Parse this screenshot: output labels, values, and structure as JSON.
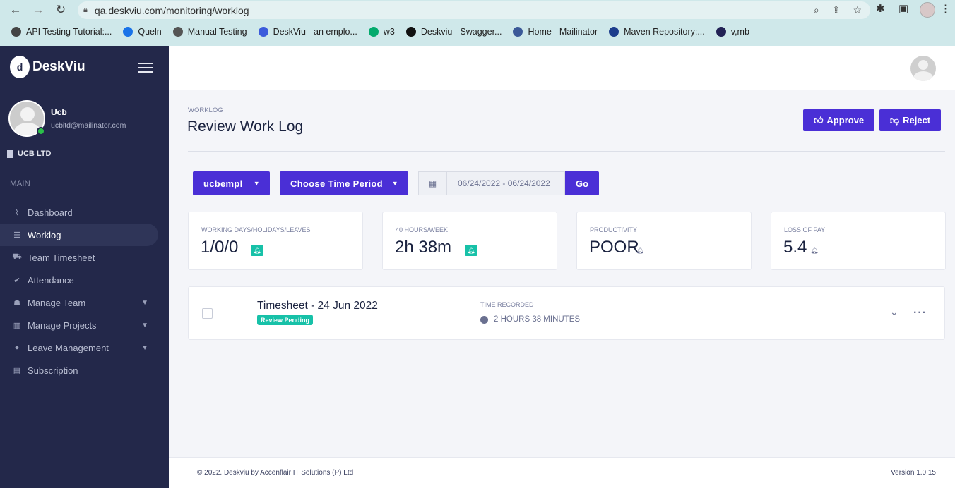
{
  "browser": {
    "url": "qa.deskviu.com/monitoring/worklog",
    "bookmarks": [
      {
        "label": "API Testing Tutorial:...",
        "icon": "api-bookmark-icon",
        "color": "#444444"
      },
      {
        "label": "Queln",
        "icon": "queln-bookmark-icon",
        "color": "#1a73e8"
      },
      {
        "label": "Manual Testing",
        "icon": "manual-testing-bookmark-icon",
        "color": "#555555"
      },
      {
        "label": "DeskViu - an emplo...",
        "icon": "deskviu-bookmark-icon",
        "color": "#3b5bdb"
      },
      {
        "label": "w3",
        "icon": "w3-bookmark-icon",
        "color": "#04aa6d"
      },
      {
        "label": "Deskviu - Swagger...",
        "icon": "swagger-bookmark-icon",
        "color": "#111111"
      },
      {
        "label": "Home - Mailinator",
        "icon": "mailinator-bookmark-icon",
        "color": "#3b5998"
      },
      {
        "label": "Maven Repository:...",
        "icon": "maven-bookmark-icon",
        "color": "#1c3d8c"
      },
      {
        "label": "v,mb",
        "icon": "vmb-bookmark-icon",
        "color": "#222255"
      }
    ]
  },
  "sidebar": {
    "brand": "DeskViu",
    "user": {
      "name": "Ucb",
      "email": "ucbitd@mailinator.com"
    },
    "company": "UCB LTD",
    "section_label": "MAIN",
    "items": [
      {
        "label": "Dashboard",
        "icon": "dashboard-icon",
        "glyph": "⌇",
        "active": false,
        "has_chevron": false
      },
      {
        "label": "Worklog",
        "icon": "worklog-icon",
        "glyph": "☰",
        "active": true,
        "has_chevron": false
      },
      {
        "label": "Team Timesheet",
        "icon": "team-timesheet-icon",
        "glyph": "⛟",
        "active": false,
        "has_chevron": false
      },
      {
        "label": "Attendance",
        "icon": "attendance-icon",
        "glyph": "✔",
        "active": false,
        "has_chevron": false
      },
      {
        "label": "Manage Team",
        "icon": "team-icon",
        "glyph": "☗",
        "active": false,
        "has_chevron": true
      },
      {
        "label": "Manage Projects",
        "icon": "projects-icon",
        "glyph": "▥",
        "active": false,
        "has_chevron": true
      },
      {
        "label": "Leave Management",
        "icon": "leave-icon",
        "glyph": "●",
        "active": false,
        "has_chevron": true
      },
      {
        "label": "Subscription",
        "icon": "subscription-icon",
        "glyph": "▤",
        "active": false,
        "has_chevron": false
      }
    ]
  },
  "header": {
    "breadcrumb": "WORKLOG",
    "title": "Review Work Log",
    "approve_label": "Approve",
    "reject_label": "Reject"
  },
  "filters": {
    "employee": "ucbempl",
    "time_period": "Choose Time Period",
    "date_range": "06/24/2022 - 06/24/2022",
    "go_label": "Go"
  },
  "stats": [
    {
      "label": "WORKING DAYS/HOLIDAYS/LEAVES",
      "value": "1/0/0",
      "bell": "teal"
    },
    {
      "label": "40 HOURS/WEEK",
      "value": "2h 38m",
      "bell": "teal"
    },
    {
      "label": "PRODUCTIVITY",
      "value": "POOR",
      "bell": "plain"
    },
    {
      "label": "LOSS OF PAY",
      "value": "5.4",
      "bell": "plain"
    }
  ],
  "timesheet": {
    "title": "Timesheet - 24 Jun 2022",
    "status": "Review Pending",
    "recorded_label": "TIME RECORDED",
    "recorded_value": "2 HOURS 38 MINUTES"
  },
  "footer": {
    "copyright": "© 2022. Deskviu by Accenflair IT Solutions (P) Ltd",
    "version": "Version 1.0.15"
  },
  "colors": {
    "sidebar_bg": "#23284a",
    "accent": "#4a2fd6",
    "badge": "#17c1a8",
    "online": "#2bbf4a"
  }
}
